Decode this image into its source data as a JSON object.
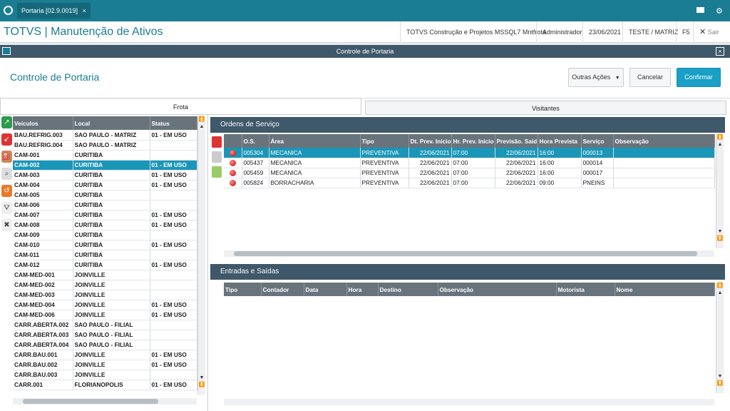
{
  "topbar": {
    "tab_label": "Portaria [02.9.0019]",
    "close_glyph": "×"
  },
  "appbar": {
    "title": "TOTVS | Manutenção de Ativos",
    "company": "TOTVS Construção e Projetos MSSQL7 Mntfrota",
    "user": "Administrador",
    "date": "23/06/2021",
    "branch": "TESTE / MATRIZ",
    "key": "F5",
    "exit": "Sair"
  },
  "dialog": {
    "title": "Controle de Portaria",
    "close_glyph": "×"
  },
  "header": {
    "page_title": "Controle de Portaria",
    "other_actions": "Outras Ações",
    "cancel": "Cancelar",
    "confirm": "Confirmar"
  },
  "tabs": {
    "frota": "Frota",
    "visitantes": "Visitantes"
  },
  "fleet": {
    "headers": [
      "Veículos",
      "Local",
      "Status"
    ],
    "rows": [
      [
        "BAU.REFRIG.003",
        "SAO PAULO - MATRIZ",
        "01 - EM USO"
      ],
      [
        "BAU.REFRIG.004",
        "SAO PAULO - MATRIZ",
        ""
      ],
      [
        "CAM-001",
        "CURITIBA",
        ""
      ],
      [
        "CAM-002",
        "CURITIBA",
        "01 - EM USO"
      ],
      [
        "CAM-003",
        "CURITIBA",
        "01 - EM USO"
      ],
      [
        "CAM-004",
        "CURITIBA",
        "01 - EM USO"
      ],
      [
        "CAM-005",
        "CURITIBA",
        ""
      ],
      [
        "CAM-006",
        "CURITIBA",
        ""
      ],
      [
        "CAM-007",
        "CURITIBA",
        "01 - EM USO"
      ],
      [
        "CAM-008",
        "CURITIBA",
        "01 - EM USO"
      ],
      [
        "CAM-009",
        "CURITIBA",
        ""
      ],
      [
        "CAM-010",
        "CURITIBA",
        "01 - EM USO"
      ],
      [
        "CAM-011",
        "CURITIBA",
        ""
      ],
      [
        "CAM-012",
        "CURITIBA",
        "01 - EM USO"
      ],
      [
        "CAM-MED-001",
        "JOINVILLE",
        ""
      ],
      [
        "CAM-MED-002",
        "JOINVILLE",
        ""
      ],
      [
        "CAM-MED-003",
        "JOINVILLE",
        ""
      ],
      [
        "CAM-MED-004",
        "JOINVILLE",
        "01 - EM USO"
      ],
      [
        "CAM-MED-006",
        "JOINVILLE",
        "01 - EM USO"
      ],
      [
        "CARR.ABERTA.002",
        "SAO PAULO - FILIAL",
        ""
      ],
      [
        "CARR.ABERTA.003",
        "SAO PAULO - FILIAL",
        ""
      ],
      [
        "CARR.ABERTA.004",
        "SAO PAULO - FILIAL",
        ""
      ],
      [
        "CARR.BAU.001",
        "JOINVILLE",
        "01 - EM USO"
      ],
      [
        "CARR.BAU.002",
        "JOINVILLE",
        "01 - EM USO"
      ],
      [
        "CARR.BAU.003",
        "JOINVILLE",
        ""
      ],
      [
        "CARR.001",
        "FLORIANOPOLIS",
        "01 - EM USO"
      ]
    ],
    "selected_index": 3
  },
  "orders": {
    "title": "Ordens de Serviço",
    "headers": [
      "",
      "O.S.",
      "Área",
      "Tipo",
      "Dt. Prev. Inicio",
      "Hr. Prev. Inicio",
      "Previsão. Saíd",
      "Hora Prevista",
      "Serviço",
      "Observação"
    ],
    "rows": [
      [
        "005304",
        "MECANICA",
        "PREVENTIVA",
        "22/06/2021",
        "07:00",
        "22/06/2021",
        "16:00",
        "000013",
        ""
      ],
      [
        "005437",
        "MECANICA",
        "PREVENTIVA",
        "22/06/2021",
        "07:00",
        "22/06/2021",
        "16:00",
        "000014",
        ""
      ],
      [
        "005459",
        "MECANICA",
        "PREVENTIVA",
        "22/06/2021",
        "07:00",
        "22/06/2021",
        "16:00",
        "000017",
        ""
      ],
      [
        "005824",
        "BORRACHARIA",
        "PREVENTIVA",
        "22/06/2021",
        "07:00",
        "22/06/2021",
        "09:00",
        "PNEINS",
        ""
      ]
    ],
    "selected_index": 0
  },
  "entries": {
    "title": "Entradas e Saídas",
    "headers": [
      "Tipo",
      "Contador",
      "Data",
      "Hora",
      "Destino",
      "Observação",
      "Motorista",
      "Nome"
    ]
  },
  "colors": {
    "accent": "#1a7d93",
    "selection": "#1a96b8",
    "header_dark": "#3f586a"
  }
}
